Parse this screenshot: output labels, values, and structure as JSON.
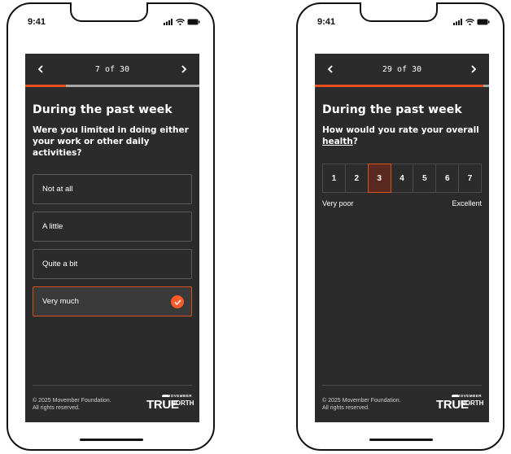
{
  "status_bar": {
    "time": "9:41"
  },
  "screen_left": {
    "nav": {
      "counter": "7 of 30",
      "progress_fraction": 0.233
    },
    "heading": "During the past week",
    "question": "Were you limited in doing either your work or other daily activities?",
    "options": [
      {
        "label": "Not at all",
        "selected": false
      },
      {
        "label": "A little",
        "selected": false
      },
      {
        "label": "Quite a bit",
        "selected": false
      },
      {
        "label": "Very much",
        "selected": true
      }
    ],
    "footer": {
      "copyright_line1": "© 2025 Movember Foundation.",
      "copyright_line2": "All rights reserved."
    }
  },
  "screen_right": {
    "nav": {
      "counter": "29 of 30",
      "progress_fraction": 0.967
    },
    "heading": "During the past week",
    "question_prefix": "How would you rate your overall ",
    "question_link": "health",
    "question_suffix": "?",
    "scale": {
      "values": [
        "1",
        "2",
        "3",
        "4",
        "5",
        "6",
        "7"
      ],
      "selected": "3",
      "min_label": "Very poor",
      "max_label": "Excellent"
    },
    "footer": {
      "copyright_line1": "© 2025 Movember Foundation.",
      "copyright_line2": "All rights reserved."
    }
  },
  "brand": {
    "small": "MOVEMBER",
    "main": "TRUE",
    "secondary": "NORTH"
  },
  "colors": {
    "accent": "#e8501e",
    "screen_bg": "#2b2b2b",
    "option_border": "#5a5a5a",
    "progress_track": "#a8a8a8"
  },
  "icons": {
    "prev": "chevron-left-icon",
    "next": "chevron-right-icon",
    "selected": "checkmark-icon",
    "signal": "signal-icon",
    "wifi": "wifi-icon",
    "battery": "battery-icon"
  }
}
